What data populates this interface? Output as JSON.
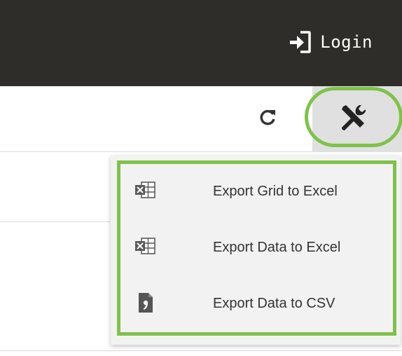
{
  "header": {
    "login_label": "Login",
    "login_icon": "sign-in-icon"
  },
  "toolbar": {
    "refresh_icon": "refresh-icon",
    "tools_icon": "tools-icon"
  },
  "export_menu": {
    "items": [
      {
        "label": "Export Grid to Excel",
        "icon": "excel-file-icon"
      },
      {
        "label": "Export Data to Excel",
        "icon": "excel-file-icon"
      },
      {
        "label": "Export Data to CSV",
        "icon": "csv-file-icon"
      }
    ]
  },
  "colors": {
    "header_bg": "#2f2d2a",
    "highlight": "#7ec24a",
    "menu_bg": "#f2f2f2",
    "tools_button_bg": "#e0e0e0"
  }
}
